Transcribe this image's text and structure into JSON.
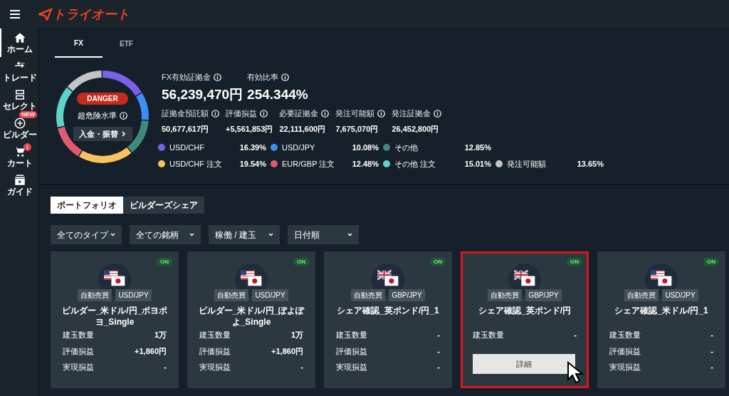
{
  "header": {
    "logo": "トライオート"
  },
  "sidebar": {
    "items": [
      {
        "label": "ホーム",
        "kind": "home",
        "selected": true
      },
      {
        "label": "トレード",
        "kind": "trade",
        "selected": false
      },
      {
        "label": "セレクト",
        "kind": "select",
        "selected": false
      },
      {
        "label": "ビルダー",
        "kind": "builder",
        "selected": false,
        "badge": "NEW"
      },
      {
        "label": "カート",
        "kind": "cart",
        "selected": false,
        "count": "1"
      },
      {
        "label": "ガイド",
        "kind": "guide",
        "selected": false
      }
    ]
  },
  "account_tabs": [
    {
      "label": "FX",
      "selected": true
    },
    {
      "label": "ETF",
      "selected": false
    }
  ],
  "margin_gauge": {
    "status": "DANGER",
    "level_label": "超危険水準",
    "button": "入金・振替",
    "chart_data": {
      "type": "donut",
      "categories": [
        "USD/CHF",
        "USD/JPY",
        "その他",
        "USD/CHF 注文",
        "EUR/GBP 注文",
        "その他 注文",
        "発注可能額"
      ],
      "series": [
        {
          "values": [
            16.39,
            10.08,
            12.85,
            19.54,
            12.48,
            15.01,
            13.65
          ]
        }
      ],
      "colors": [
        "#7b61e8",
        "#3d8ef0",
        "#3f8a7c",
        "#f7c35c",
        "#e35a70",
        "#5fd3c8",
        "#c4c4c4"
      ],
      "value_labels": [
        "16.39%",
        "10.08%",
        "12.85%",
        "19.54%",
        "12.48%",
        "15.01%",
        "13.65%"
      ]
    }
  },
  "summary": [
    {
      "label": "FX有効証拠金",
      "value": "56,239,470円"
    },
    {
      "label": "有効比率",
      "value": "254.344%"
    }
  ],
  "details": [
    {
      "label": "証拠金預託額",
      "value": "50,677,617円"
    },
    {
      "label": "評価損益",
      "value": "+5,561,853円"
    },
    {
      "label": "必要証拠金",
      "value": "22,111,600円"
    },
    {
      "label": "発注可能額",
      "value": "7,675,070円"
    },
    {
      "label": "発注証拠金",
      "value": "26,452,800円"
    }
  ],
  "view_tabs": [
    {
      "label": "ポートフォリオ",
      "selected": true
    },
    {
      "label": "ビルダーズシェア",
      "selected": false
    }
  ],
  "filters": [
    "全てのタイプ",
    "全ての銘柄",
    "稼働 / 建玉",
    "日付順"
  ],
  "cards": [
    {
      "status": "ON",
      "kind": "usd",
      "type": "自動売買",
      "pair": "USD/JPY",
      "title": "ビルダー_米ドル/円_ポヨポヨ_Single",
      "selected": false,
      "rows": [
        {
          "label": "建玉数量",
          "value": "1万"
        },
        {
          "label": "評価損益",
          "value": "+1,860円"
        },
        {
          "label": "実現損益",
          "value": "-"
        }
      ]
    },
    {
      "status": "ON",
      "kind": "usd",
      "type": "自動売買",
      "pair": "USD/JPY",
      "title": "ビルダー_米ドル/円_ぽよぽよ_Single",
      "selected": false,
      "rows": [
        {
          "label": "建玉数量",
          "value": "1万"
        },
        {
          "label": "評価損益",
          "value": "+1,860円"
        },
        {
          "label": "実現損益",
          "value": "-"
        }
      ]
    },
    {
      "status": "ON",
      "kind": "gbp",
      "type": "自動売買",
      "pair": "GBP/JPY",
      "title": "シェア確認_英ポンド/円_1",
      "selected": false,
      "rows": [
        {
          "label": "建玉数量",
          "value": "-"
        },
        {
          "label": "評価損益",
          "value": "-"
        },
        {
          "label": "実現損益",
          "value": "-"
        }
      ]
    },
    {
      "status": "ON",
      "kind": "gbp",
      "type": "自動売買",
      "pair": "GBP/JPY",
      "title": "シェア確認_英ポンド/円",
      "selected": true,
      "hover_button": "詳細",
      "rows": [
        {
          "label": "建玉数量",
          "value": "-"
        }
      ]
    },
    {
      "status": "ON",
      "kind": "usd",
      "type": "自動売買",
      "pair": "USD/JPY",
      "title": "シェア確認_米ドル/円_1",
      "selected": false,
      "rows": [
        {
          "label": "建玉数量",
          "value": "-"
        },
        {
          "label": "評価損益",
          "value": "-"
        },
        {
          "label": "実現損益",
          "value": "-"
        }
      ]
    }
  ]
}
